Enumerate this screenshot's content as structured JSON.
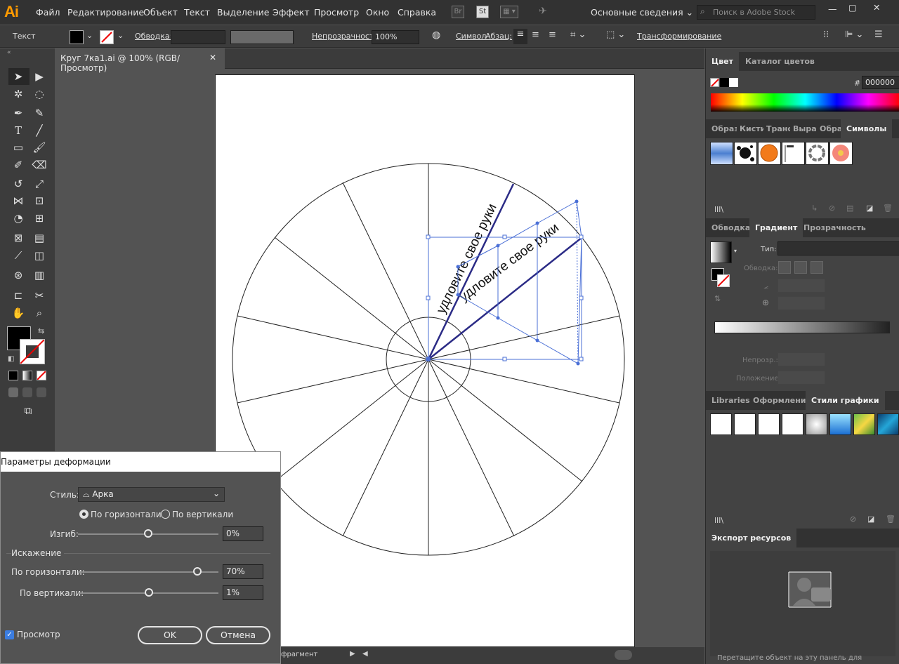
{
  "menubar": {
    "logo": "Ai",
    "items": [
      "Файл",
      "Редактирование",
      "Объект",
      "Текст",
      "Выделение",
      "Эффект",
      "Просмотр",
      "Окно",
      "Справка"
    ],
    "bridge": "Br",
    "stock": "St",
    "workspace": "Основные сведения",
    "search_placeholder": "Поиск в Adobe Stock"
  },
  "control": {
    "mode": "Текст",
    "stroke_label": "Обводка:",
    "opacity_label": "Непрозрачность:",
    "opacity_value": "100%",
    "symbol": "Символ",
    "paragraph": "Абзац:",
    "transform": "Трансформирование"
  },
  "document": {
    "tab_title": "Круг 7ка1.ai @ 100% (RGB/Просмотр)",
    "text1": "удловите свое руки",
    "text2": "удловите свое руки",
    "status_tool": "фрагмент"
  },
  "panels": {
    "color": {
      "tabs": [
        "Цвет",
        "Каталог цветов"
      ],
      "hex_label": "#",
      "hex_value": "000000"
    },
    "symbols": {
      "tabs": [
        "Образ",
        "Кисти",
        "Транс",
        "Выра",
        "Образ",
        "Символы"
      ]
    },
    "gradient": {
      "tabs": [
        "Обводка",
        "Градиент",
        "Прозрачность"
      ],
      "type_label": "Тип:",
      "stroke_label": "Обводка:",
      "opacity_label": "Непрозр.:",
      "position_label": "Положение:"
    },
    "graphic_styles": {
      "tabs": [
        "Libraries",
        "Оформление",
        "Стили графики"
      ]
    },
    "export": {
      "tab": "Экспорт ресурсов",
      "hint": "Перетащите объект на эту панель для"
    }
  },
  "dialog": {
    "title": "Параметры деформации",
    "style_label": "Стиль:",
    "style_value": "Арка",
    "horizontal": "По горизонтали",
    "vertical": "По вертикали",
    "bend_label": "Изгиб:",
    "bend_value": "0%",
    "bend_level": 0,
    "distortion_header": "Искажение",
    "dist_h_label": "По горизонтали:",
    "dist_h_value": "70%",
    "dist_h_level": 70,
    "dist_v_label": "По вертикали:",
    "dist_v_value": "1%",
    "dist_v_level": 1,
    "preview_label": "Просмотр",
    "ok": "OK",
    "cancel": "Отмена"
  },
  "colors": {
    "accent": "#ff9a00",
    "selection": "#4a6fd6",
    "spoke": "#2b2b86"
  }
}
